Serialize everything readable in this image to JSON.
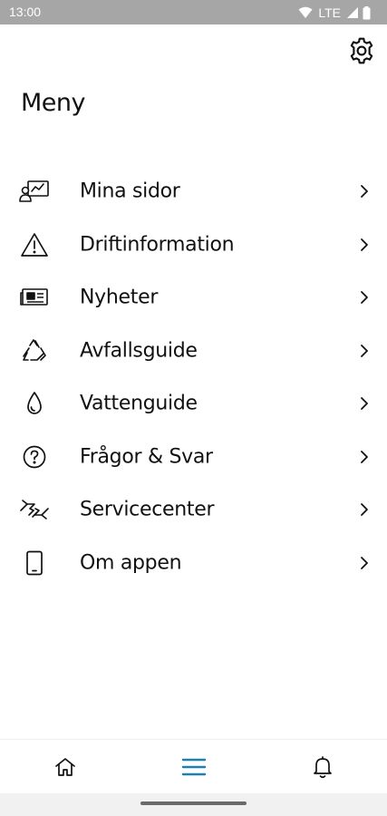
{
  "status_bar": {
    "time": "13:00",
    "network": "LTE",
    "icons": [
      "wifi-icon",
      "cellular-signal-icon",
      "battery-icon"
    ]
  },
  "header": {
    "settings_icon": "gear-icon"
  },
  "page": {
    "title": "Meny"
  },
  "menu": {
    "items": [
      {
        "label": "Mina sidor",
        "icon": "user-dashboard-icon"
      },
      {
        "label": "Driftinformation",
        "icon": "warning-triangle-icon"
      },
      {
        "label": "Nyheter",
        "icon": "newspaper-icon"
      },
      {
        "label": "Avfallsguide",
        "icon": "recycle-icon"
      },
      {
        "label": "Vattenguide",
        "icon": "water-drop-icon"
      },
      {
        "label": "Frågor & Svar",
        "icon": "question-circle-icon"
      },
      {
        "label": "Servicecenter",
        "icon": "handshake-icon"
      },
      {
        "label": "Om appen",
        "icon": "phone-icon"
      }
    ]
  },
  "bottom_nav": {
    "items": [
      {
        "icon": "home-icon",
        "active": false
      },
      {
        "icon": "menu-icon",
        "active": true
      },
      {
        "icon": "bell-icon",
        "active": false
      }
    ]
  },
  "colors": {
    "accent": "#1f7fb0",
    "text": "#111111",
    "status_bar": "#a6a6a6"
  }
}
